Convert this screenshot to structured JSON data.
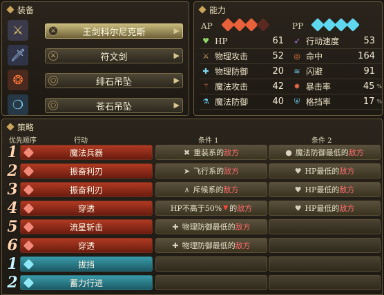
{
  "equipment": {
    "title": "装备",
    "items": [
      {
        "name": "王剑科尔尼克斯",
        "selected": true,
        "icon": "sword-icon",
        "slot_icon": "sword-slot-icon"
      },
      {
        "name": "符文剑",
        "selected": false,
        "icon": "rune-sword-icon",
        "slot_icon": "sword-slot-icon"
      },
      {
        "name": "绯石吊坠",
        "selected": false,
        "icon": "red-pendant-icon",
        "slot_icon": "ring-slot-icon"
      },
      {
        "name": "苍石吊坠",
        "selected": false,
        "icon": "blue-pendant-icon",
        "slot_icon": "ring-slot-icon"
      }
    ]
  },
  "stats": {
    "title": "能力",
    "ap_label": "AP",
    "pp_label": "PP",
    "ap_gems": 4,
    "ap_color": "#e8613a",
    "pp_gems": 4,
    "pp_color": "#5fd8ef",
    "left": [
      {
        "label": "HP",
        "value": "61",
        "icon": "heart-icon",
        "color": "#8fd86a"
      },
      {
        "label": "物理攻击",
        "value": "52",
        "icon": "sword-attack-icon",
        "color": "#d9a36a"
      },
      {
        "label": "物理防御",
        "value": "20",
        "icon": "armor-icon",
        "color": "#7fd6f0"
      },
      {
        "label": "魔法攻击",
        "value": "42",
        "icon": "staff-icon",
        "color": "#e77a4a"
      },
      {
        "label": "魔法防御",
        "value": "40",
        "icon": "flask-icon",
        "color": "#6ecbef"
      }
    ],
    "right": [
      {
        "label": "行动速度",
        "value": "53",
        "icon": "speed-icon",
        "color": "#b47ae8",
        "unit": ""
      },
      {
        "label": "命中",
        "value": "164",
        "icon": "target-icon",
        "color": "#e77a4a",
        "unit": ""
      },
      {
        "label": "闪避",
        "value": "91",
        "icon": "evade-icon",
        "color": "#6ecbef",
        "unit": ""
      },
      {
        "label": "暴击率",
        "value": "45",
        "icon": "crit-icon",
        "color": "#e86a4a",
        "unit": "%"
      },
      {
        "label": "格挡率",
        "value": "17",
        "icon": "shield-icon",
        "color": "#6ecbef",
        "unit": "%"
      }
    ]
  },
  "strategy": {
    "title": "策略",
    "headers": {
      "priority": "优先顺序",
      "action": "行动",
      "cond1": "条件 1",
      "cond2": "条件 2"
    },
    "rows": [
      {
        "num": "1",
        "color": "red",
        "action": "魔法兵器",
        "c1": {
          "icon": "✖",
          "pre": "重装系的",
          "hl": "敌方",
          "post": ""
        },
        "c2": {
          "icon": "●",
          "pre": "魔法防御最低的",
          "hl": "敌方",
          "post": ""
        }
      },
      {
        "num": "2",
        "color": "red",
        "action": "振奋利刃",
        "c1": {
          "icon": "➤",
          "pre": "飞行系的",
          "hl": "敌方",
          "post": ""
        },
        "c2": {
          "icon": "♥",
          "pre": "HP最低的",
          "hl": "敌方",
          "post": ""
        }
      },
      {
        "num": "3",
        "color": "red",
        "action": "振奋利刃",
        "c1": {
          "icon": "∧",
          "pre": "斥候系的",
          "hl": "敌方",
          "post": ""
        },
        "c2": {
          "icon": "♥",
          "pre": "HP最低的",
          "hl": "敌方",
          "post": ""
        }
      },
      {
        "num": "4",
        "color": "red",
        "action": "穿透",
        "c1": {
          "icon": "",
          "pre": "HP不高于50%",
          "tri": "▼",
          "mid": "的",
          "hl": "敌方",
          "post": ""
        },
        "c2": {
          "icon": "♥",
          "pre": "HP最低的",
          "hl": "敌方",
          "post": ""
        }
      },
      {
        "num": "5",
        "color": "red",
        "action": "流星斩击",
        "c1": {
          "icon": "✚",
          "pre": "物理防御最低的",
          "hl": "敌方",
          "post": ""
        },
        "c2": null
      },
      {
        "num": "6",
        "color": "red",
        "action": "穿透",
        "c1": {
          "icon": "✚",
          "pre": "物理防御最低的",
          "hl": "敌方",
          "post": ""
        },
        "c2": null
      },
      {
        "num": "1",
        "color": "blue",
        "action": "拔挡",
        "c1": null,
        "c2": null
      },
      {
        "num": "2",
        "color": "blue",
        "action": "蓄力行进",
        "c1": null,
        "c2": null
      }
    ]
  }
}
